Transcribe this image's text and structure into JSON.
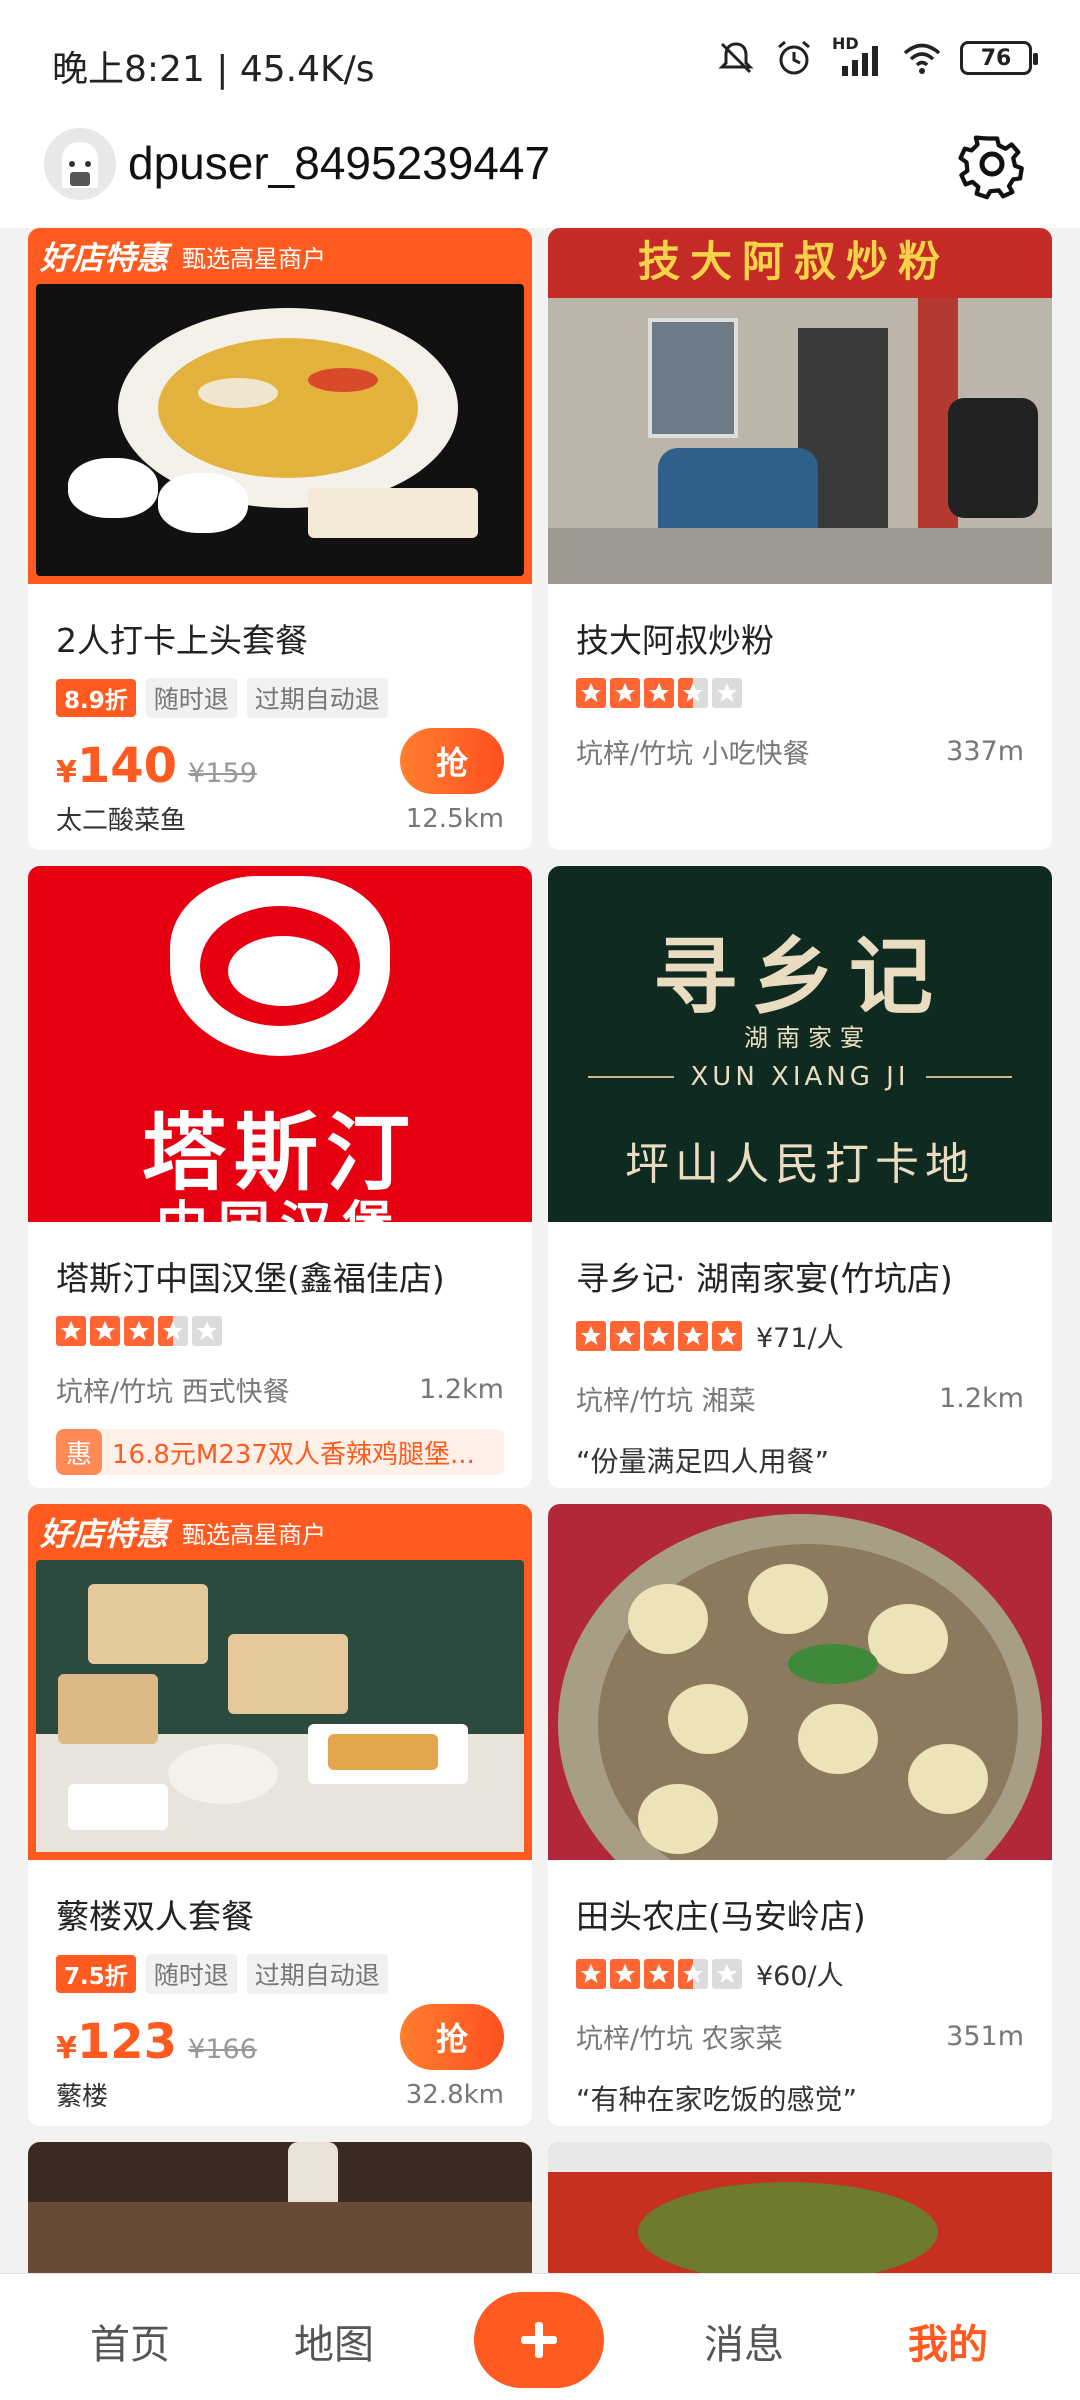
{
  "status_bar": {
    "time": "晚上8:21 | 45.4K/s",
    "battery": "76",
    "network_badge": "HD",
    "icons": [
      "mute-icon",
      "alarm-icon",
      "signal-icon",
      "wifi-icon",
      "battery-icon"
    ]
  },
  "header": {
    "username": "dpuser_8495239447",
    "settings_icon": "gear-icon"
  },
  "cards": [
    {
      "badge": "好店特惠",
      "badge_sub": "甄选高星商户",
      "title": "2人打卡上头套餐",
      "discount": "8.9折",
      "tags": [
        "随时退",
        "过期自动退"
      ],
      "price_symbol": "¥",
      "price": "140",
      "original_price": "¥159",
      "grab_label": "抢",
      "shop": "太二酸菜鱼",
      "distance": "12.5km"
    },
    {
      "title": "技大阿叔炒粉",
      "rating": 3.5,
      "area": "坑梓/竹坑 小吃快餐",
      "distance": "337m"
    },
    {
      "title": "塔斯汀中国汉堡(鑫福佳店)",
      "rating": 3.5,
      "area": "坑梓/竹坑 西式快餐",
      "distance": "1.2km",
      "promo_icon": "惠",
      "promo": "16.8元M237双人香辣鸡腿堡..."
    },
    {
      "title": "寻乡记· 湖南家宴(竹坑店)",
      "rating": 5,
      "per_capita": "¥71/人",
      "area": "坑梓/竹坑 湘菜",
      "distance": "1.2km",
      "review": "“份量满足四人用餐”",
      "image_text": {
        "main": "寻乡记",
        "sub": "湖南家宴",
        "pinyin": "XUN XIANG JI",
        "slogan": "坪山人民打卡地"
      }
    },
    {
      "badge": "好店特惠",
      "badge_sub": "甄选高星商户",
      "title": "蘩楼双人套餐",
      "discount": "7.5折",
      "tags": [
        "随时退",
        "过期自动退"
      ],
      "price_symbol": "¥",
      "price": "123",
      "original_price": "¥166",
      "grab_label": "抢",
      "shop": "蘩楼",
      "distance": "32.8km"
    },
    {
      "title": "田头农庄(马安岭店)",
      "rating": 3.5,
      "per_capita": "¥60/人",
      "area": "坑梓/竹坑 农家菜",
      "distance": "351m",
      "review": "“有种在家吃饭的感觉”"
    }
  ],
  "images": {
    "card1": {
      "sign": "技大阿叔炒粉"
    },
    "card2": {
      "logo_text": "塔斯汀",
      "sub": "中国汉堡"
    }
  },
  "bottom_nav": {
    "items": [
      "首页",
      "地图",
      "消息",
      "我的"
    ],
    "active": "我的",
    "plus_icon": "plus-icon"
  },
  "colors": {
    "accent": "#ff5a1f",
    "star": "#ff6633"
  }
}
